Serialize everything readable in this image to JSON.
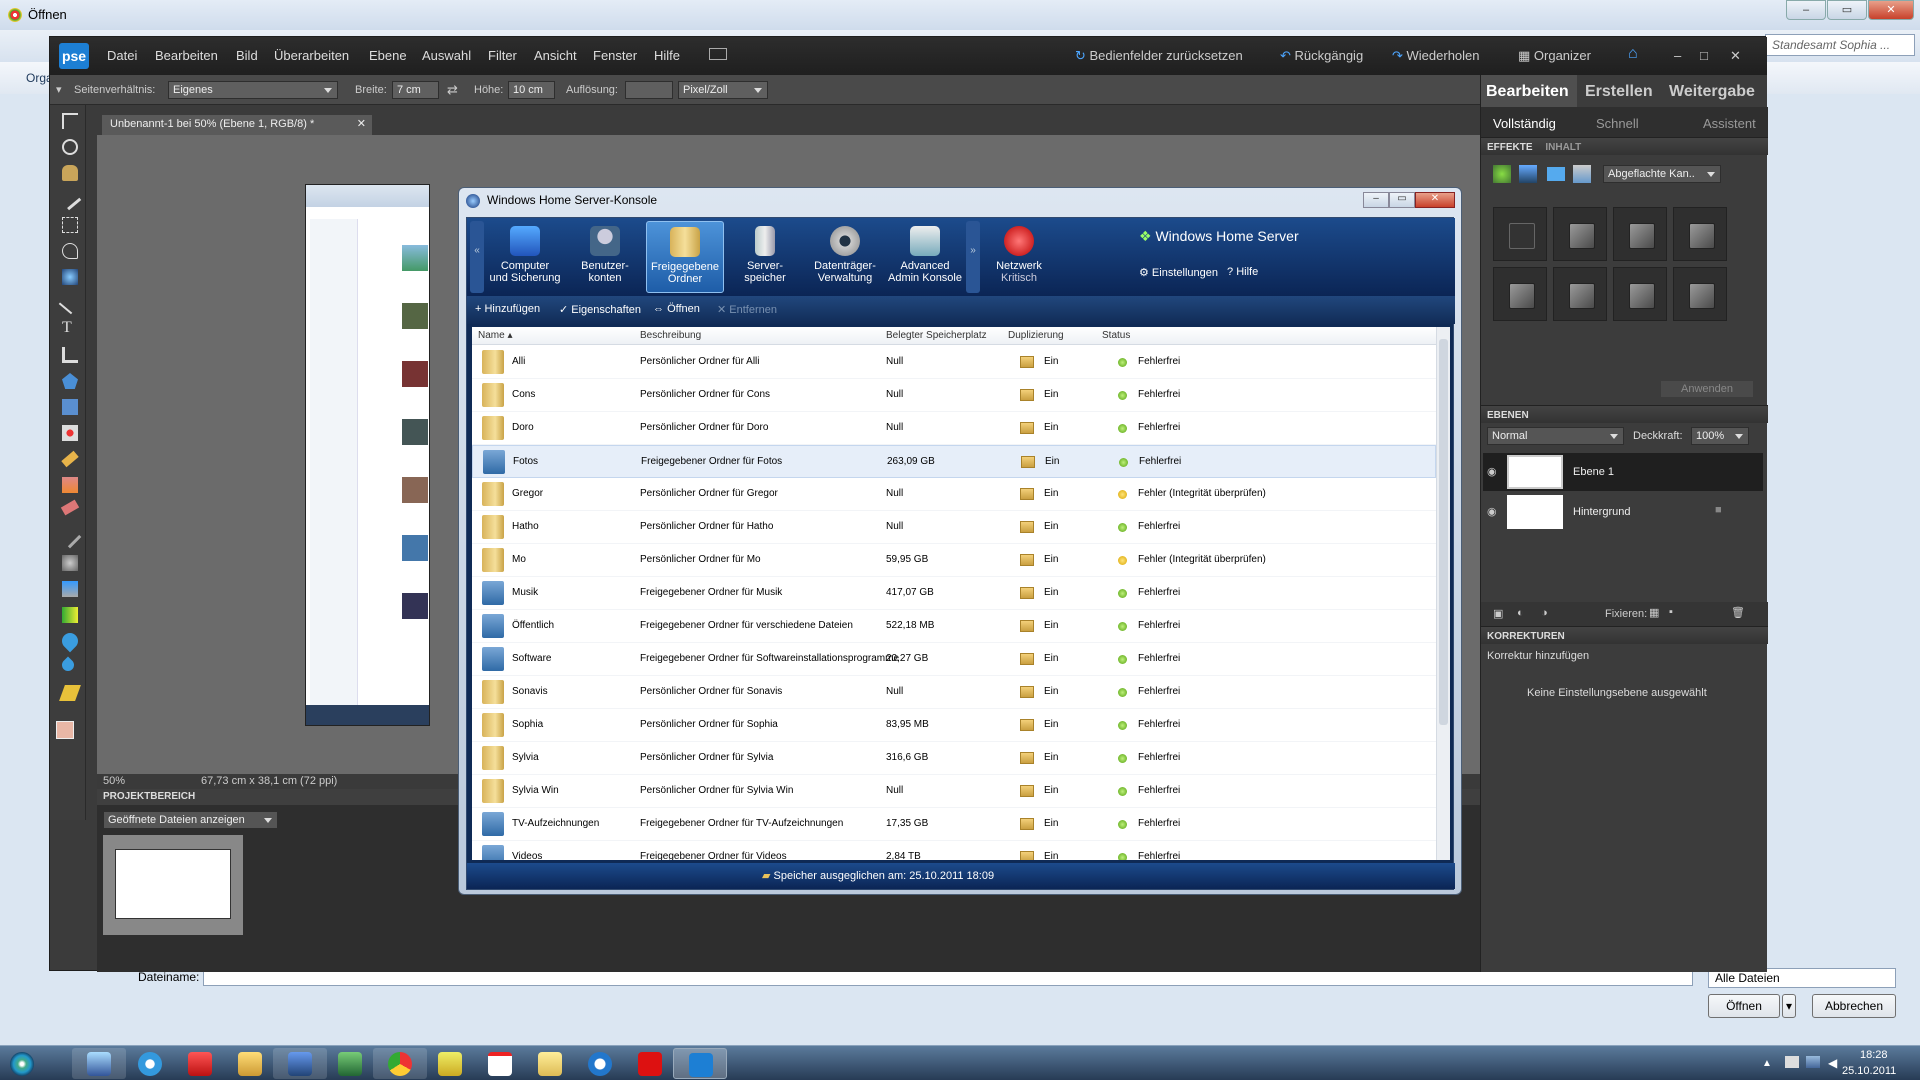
{
  "bg_dialog": {
    "title": "Öffnen",
    "filename_label": "Dateiname:",
    "filetype": "Alle Dateien",
    "open_button": "Öffnen",
    "cancel_button": "Abbrechen",
    "search_placeholder": "Standesamt Sophia ...",
    "org": "Orga"
  },
  "pse": {
    "logo": "pse",
    "menu": [
      "Datei",
      "Bearbeiten",
      "Bild",
      "Überarbeiten",
      "Ebene",
      "Auswahl",
      "Filter",
      "Ansicht",
      "Fenster",
      "Hilfe"
    ],
    "actions": {
      "reset": "Bedienfelder zurücksetzen",
      "undo": "Rückgängig",
      "redo": "Wiederholen",
      "organizer": "Organizer"
    },
    "options": {
      "ratio_label": "Seitenverhältnis:",
      "ratio_value": "Eigenes",
      "width_label": "Breite:",
      "width_value": "7 cm",
      "height_label": "Höhe:",
      "height_value": "10 cm",
      "resolution_label": "Auflösung:",
      "resolution_value": "",
      "unit_value": "Pixel/Zoll"
    },
    "doc_tab": "Unbenannt-1 bei 50% (Ebene 1, RGB/8) *",
    "status": {
      "zoom": "50%",
      "size": "67,73 cm x 38,1 cm (72 ppi)"
    },
    "project": {
      "heading": "PROJEKTBEREICH",
      "dropdown": "Geöffnete Dateien anzeigen"
    },
    "right": {
      "tabs": [
        "Bearbeiten",
        "Erstellen",
        "Weitergabe"
      ],
      "modes": [
        "Vollständig",
        "Schnell",
        "Assistent"
      ],
      "effects_tab": "EFFEKTE",
      "content_tab": "INHALT",
      "effects_dropdown": "Abgeflachte Kan..",
      "apply": "Anwenden",
      "layers_head": "EBENEN",
      "blend": "Normal",
      "opacity_label": "Deckkraft:",
      "opacity": "100%",
      "layers": [
        {
          "name": "Ebene 1"
        },
        {
          "name": "Hintergrund"
        }
      ],
      "lock_label": "Fixieren:",
      "corrections_head": "KORREKTUREN",
      "add_correction": "Korrektur hinzufügen",
      "no_adjustment": "Keine Einstellungsebene ausgewählt"
    }
  },
  "whs": {
    "title": "Windows Home Server-Konsole",
    "brand": "Windows Home Server",
    "nav": [
      {
        "line1": "Computer",
        "line2": "und Sicherung",
        "icon": "computer-backup-icon"
      },
      {
        "line1": "Benutzer-",
        "line2": "konten",
        "icon": "user-accounts-icon"
      },
      {
        "line1": "Freigegebene",
        "line2": "Ordner",
        "icon": "shared-folders-icon"
      },
      {
        "line1": "Server-",
        "line2": "speicher",
        "icon": "server-storage-icon"
      },
      {
        "line1": "Datenträger-",
        "line2": "Verwaltung",
        "icon": "disk-management-icon"
      },
      {
        "line1": "Advanced",
        "line2": "Admin Konsole",
        "icon": "advanced-admin-icon"
      }
    ],
    "network": {
      "line1": "Netzwerk",
      "line2": "Kritisch"
    },
    "settings": "Einstellungen",
    "help": "Hilfe",
    "toolbar": {
      "add": "Hinzufügen",
      "properties": "Eigenschaften",
      "open": "Öffnen",
      "remove": "Entfernen"
    },
    "columns": [
      "Name",
      "Beschreibung",
      "Belegter Speicherplatz",
      "Duplizierung",
      "Status"
    ],
    "rows": [
      {
        "name": "Alli",
        "desc": "Persönlicher Ordner für Alli",
        "size": "Null",
        "dup": "Ein",
        "status": "Fehlerfrei"
      },
      {
        "name": "Cons",
        "desc": "Persönlicher Ordner für Cons",
        "size": "Null",
        "dup": "Ein",
        "status": "Fehlerfrei"
      },
      {
        "name": "Doro",
        "desc": "Persönlicher Ordner für Doro",
        "size": "Null",
        "dup": "Ein",
        "status": "Fehlerfrei"
      },
      {
        "name": "Fotos",
        "desc": "Freigegebener Ordner für Fotos",
        "size": "263,09 GB",
        "dup": "Ein",
        "status": "Fehlerfrei"
      },
      {
        "name": "Gregor",
        "desc": "Persönlicher Ordner für Gregor",
        "size": "Null",
        "dup": "Ein",
        "status": "Fehler (Integrität überprüfen)"
      },
      {
        "name": "Hatho",
        "desc": "Persönlicher Ordner für Hatho",
        "size": "Null",
        "dup": "Ein",
        "status": "Fehlerfrei"
      },
      {
        "name": "Mo",
        "desc": "Persönlicher Ordner für Mo",
        "size": "59,95 GB",
        "dup": "Ein",
        "status": "Fehler (Integrität überprüfen)"
      },
      {
        "name": "Musik",
        "desc": "Freigegebener Ordner für Musik",
        "size": "417,07 GB",
        "dup": "Ein",
        "status": "Fehlerfrei"
      },
      {
        "name": "Öffentlich",
        "desc": "Freigegebener Ordner für verschiedene Dateien",
        "size": "522,18 MB",
        "dup": "Ein",
        "status": "Fehlerfrei"
      },
      {
        "name": "Software",
        "desc": "Freigegebener Ordner für Softwareinstallationsprogramme",
        "size": "20,27 GB",
        "dup": "Ein",
        "status": "Fehlerfrei"
      },
      {
        "name": "Sonavis",
        "desc": "Persönlicher Ordner für Sonavis",
        "size": "Null",
        "dup": "Ein",
        "status": "Fehlerfrei"
      },
      {
        "name": "Sophia",
        "desc": "Persönlicher Ordner für Sophia",
        "size": "83,95 MB",
        "dup": "Ein",
        "status": "Fehlerfrei"
      },
      {
        "name": "Sylvia",
        "desc": "Persönlicher Ordner für Sylvia",
        "size": "316,6 GB",
        "dup": "Ein",
        "status": "Fehlerfrei"
      },
      {
        "name": "Sylvia Win",
        "desc": "Persönlicher Ordner für Sylvia Win",
        "size": "Null",
        "dup": "Ein",
        "status": "Fehlerfrei"
      },
      {
        "name": "TV-Aufzeichnungen",
        "desc": "Freigegebener Ordner für TV-Aufzeichnungen",
        "size": "17,35 GB",
        "dup": "Ein",
        "status": "Fehlerfrei"
      },
      {
        "name": "Videos",
        "desc": "Freigegebener Ordner für Videos",
        "size": "2,84 TB",
        "dup": "Ein",
        "status": "Fehlerfrei"
      }
    ],
    "statusbar": "Speicher ausgeglichen am: 25.10.2011 18:09"
  },
  "taskbar": {
    "time": "18:28",
    "date": "25.10.2011"
  }
}
